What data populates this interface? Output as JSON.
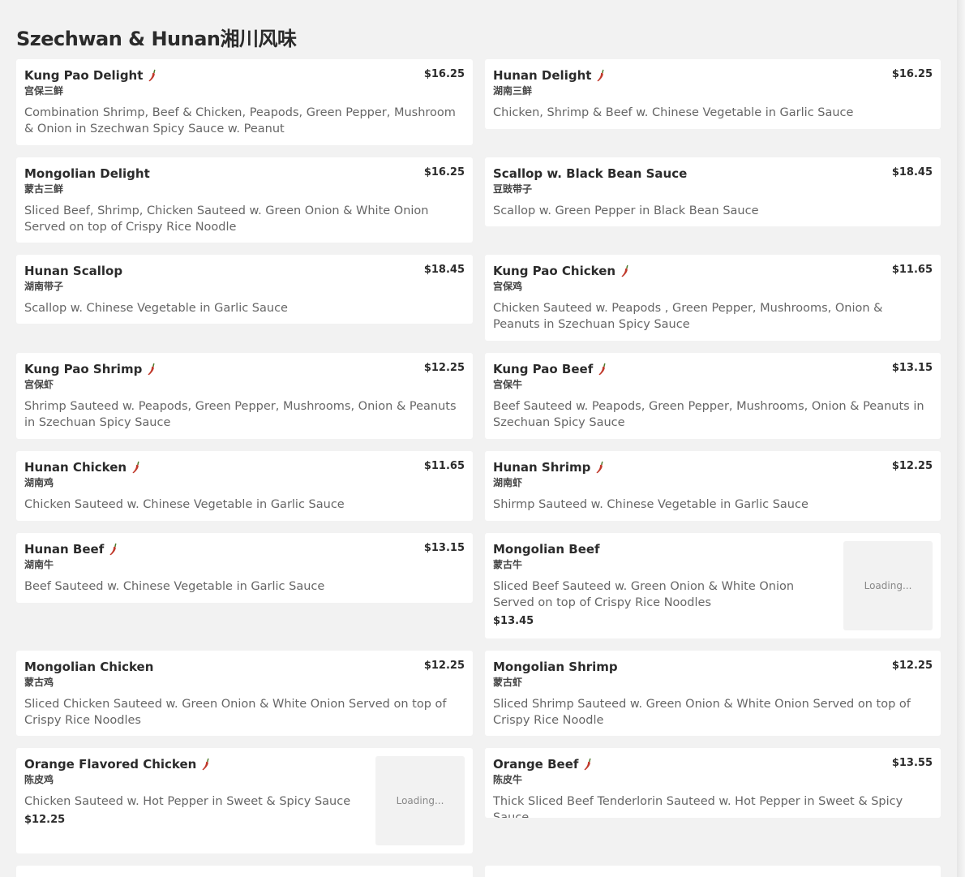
{
  "section": {
    "title": "Szechwan & Hunan湘川风味"
  },
  "loading_text": "Loading...",
  "colors": {
    "background": "#f2f2f2",
    "card": "#ffffff",
    "pepper": "#c0392b"
  },
  "items": [
    {
      "name": "Kung Pao Delight",
      "cn": "宫保三鲜",
      "price": "$16.25",
      "spicy": true,
      "desc": "Combination Shrimp, Beef & Chicken, Peapods, Green Pepper, Mushroom & Onion in Szechwan Spicy Sauce w. Peanut"
    },
    {
      "name": "Hunan Delight",
      "cn": "湖南三鲜",
      "price": "$16.25",
      "spicy": true,
      "desc": "Chicken, Shrimp & Beef w. Chinese Vegetable in Garlic Sauce"
    },
    {
      "name": "Mongolian Delight",
      "cn": "蒙古三鲜",
      "price": "$16.25",
      "spicy": false,
      "desc": "Sliced Beef, Shrimp, Chicken Sauteed w. Green Onion & White Onion Served on top of Crispy Rice Noodle"
    },
    {
      "name": "Scallop w. Black Bean Sauce",
      "cn": "豆豉带子",
      "price": "$18.45",
      "spicy": false,
      "desc": "Scallop w. Green Pepper in Black Bean Sauce"
    },
    {
      "name": "Hunan Scallop",
      "cn": "湖南带子",
      "price": "$18.45",
      "spicy": false,
      "desc": "Scallop w. Chinese Vegetable in Garlic Sauce"
    },
    {
      "name": "Kung Pao Chicken",
      "cn": "宫保鸡",
      "price": "$11.65",
      "spicy": true,
      "desc": "Chicken Sauteed w. Peapods , Green Pepper, Mushrooms, Onion & Peanuts in Szechuan Spicy Sauce"
    },
    {
      "name": "Kung Pao Shrimp",
      "cn": "宫保虾",
      "price": "$12.25",
      "spicy": true,
      "desc": "Shrimp Sauteed w. Peapods, Green Pepper, Mushrooms, Onion & Peanuts in Szechuan Spicy Sauce"
    },
    {
      "name": "Kung Pao Beef",
      "cn": "宫保牛",
      "price": "$13.15",
      "spicy": true,
      "desc": "Beef Sauteed w. Peapods, Green Pepper, Mushrooms, Onion & Peanuts in Szechuan Spicy Sauce"
    },
    {
      "name": "Hunan Chicken",
      "cn": "湖南鸡",
      "price": "$11.65",
      "spicy": true,
      "desc": "Chicken Sauteed w. Chinese Vegetable in Garlic Sauce"
    },
    {
      "name": "Hunan Shrimp",
      "cn": "湖南虾",
      "price": "$12.25",
      "spicy": true,
      "desc": "Shirmp Sauteed w. Chinese Vegetable in Garlic Sauce"
    },
    {
      "name": "Hunan Beef",
      "cn": "湖南牛",
      "price": "$13.15",
      "spicy": true,
      "desc": "Beef Sauteed w. Chinese Vegetable in Garlic Sauce"
    },
    {
      "name": "Mongolian Beef",
      "cn": "蒙古牛",
      "price": "$13.45",
      "spicy": false,
      "thumb": true,
      "desc": "Sliced Beef Sauteed w. Green Onion & White Onion Served on top of Crispy Rice Noodles"
    },
    {
      "name": "Mongolian Chicken",
      "cn": "蒙古鸡",
      "price": "$12.25",
      "spicy": false,
      "desc": "Sliced Chicken Sauteed w. Green Onion & White Onion Served on top of Crispy Rice Noodles"
    },
    {
      "name": "Mongolian Shrimp",
      "cn": "蒙古虾",
      "price": "$12.25",
      "spicy": false,
      "desc": "Sliced Shrimp Sauteed w. Green Onion & White Onion Served on top of Crispy Rice Noodle"
    },
    {
      "name": "Orange Flavored Chicken",
      "cn": "陈皮鸡",
      "price": "$12.25",
      "spicy": true,
      "thumb": true,
      "desc": "Chicken Sauteed w. Hot Pepper in Sweet & Spicy Sauce"
    },
    {
      "name": "Orange Beef",
      "cn": "陈皮牛",
      "price": "$13.55",
      "spicy": true,
      "desc": "Thick Sliced Beef Tenderlorin Sauteed w. Hot Pepper in Sweet & Spicy Sauce"
    }
  ]
}
